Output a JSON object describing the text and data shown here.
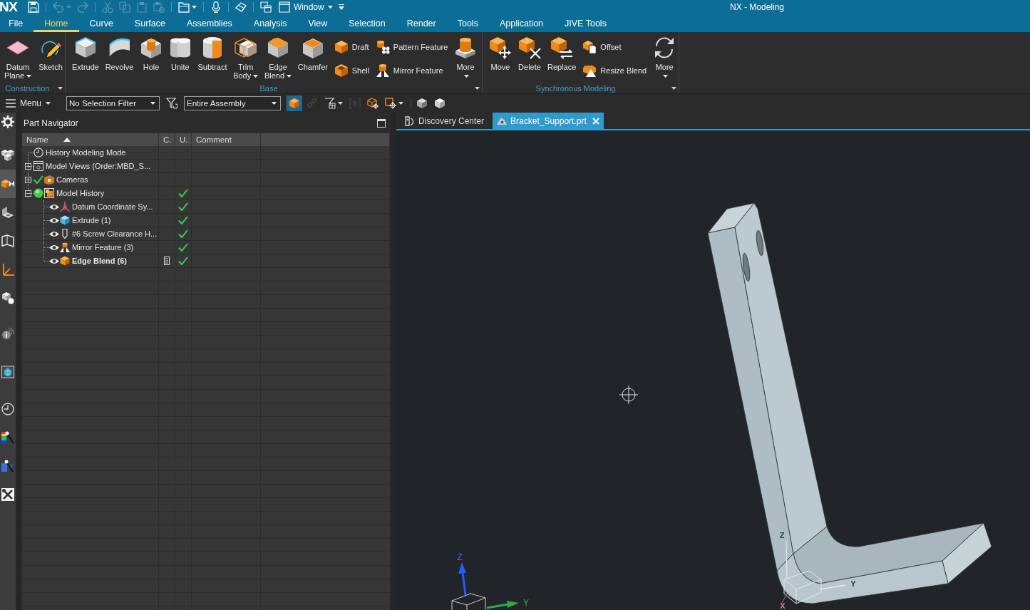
{
  "window": {
    "logo": "NX",
    "title": "NX - Modeling"
  },
  "quick_access": {
    "groups": [
      [
        {
          "disabled": false,
          "dropdown": false
        }
      ],
      [
        {
          "disabled": true,
          "dropdown": true
        },
        {
          "disabled": true,
          "dropdown": false
        }
      ],
      [
        {
          "disabled": true,
          "dropdown": false
        },
        {
          "disabled": true,
          "dropdown": false
        },
        {
          "disabled": true,
          "dropdown": false
        },
        {
          "disabled": true,
          "dropdown": false
        }
      ],
      [
        {
          "disabled": false,
          "dropdown": true
        }
      ],
      [
        {
          "disabled": false,
          "dropdown": false
        }
      ],
      [
        {
          "disabled": false,
          "dropdown": false
        }
      ],
      [
        {
          "disabled": false,
          "dropdown": false
        }
      ]
    ],
    "window_menu": "Window"
  },
  "ribbon_tabs": [
    {
      "label": "File",
      "selected": false
    },
    {
      "label": "Home",
      "selected": true
    },
    {
      "label": "Curve",
      "selected": false
    },
    {
      "label": "Surface",
      "selected": false
    },
    {
      "label": "Assemblies",
      "selected": false
    },
    {
      "label": "Analysis",
      "selected": false
    },
    {
      "label": "View",
      "selected": false
    },
    {
      "label": "Selection",
      "selected": false
    },
    {
      "label": "Render",
      "selected": false
    },
    {
      "label": "Tools",
      "selected": false
    },
    {
      "label": "Application",
      "selected": false
    },
    {
      "label": "JIVE Tools",
      "selected": false
    }
  ],
  "ribbon_groups": [
    {
      "title": "Construction",
      "items": [
        {
          "kind": "large",
          "label": "Datum Plane",
          "dropdown": true
        },
        {
          "kind": "large",
          "label": "Sketch",
          "dropdown": false
        }
      ]
    },
    {
      "title": "Base",
      "items": [
        {
          "kind": "large",
          "label": "Extrude",
          "dropdown": false
        },
        {
          "kind": "large",
          "label": "Revolve",
          "dropdown": false
        },
        {
          "kind": "large",
          "label": "Hole",
          "dropdown": false
        },
        {
          "kind": "large",
          "label": "Unite",
          "dropdown": false
        },
        {
          "kind": "large",
          "label": "Subtract",
          "dropdown": false
        },
        {
          "kind": "large",
          "label": "Trim Body",
          "dropdown": true
        },
        {
          "kind": "large",
          "label": "Edge Blend",
          "dropdown": true
        },
        {
          "kind": "large",
          "label": "Chamfer",
          "dropdown": false
        },
        {
          "kind": "stack",
          "items": [
            {
              "label": "Draft"
            },
            {
              "label": "Shell"
            }
          ]
        },
        {
          "kind": "stack",
          "items": [
            {
              "label": "Pattern Feature"
            },
            {
              "label": "Mirror Feature"
            }
          ]
        },
        {
          "kind": "large",
          "label": "More",
          "dropdown": true
        }
      ]
    },
    {
      "title": "Synchronous Modeling",
      "items": [
        {
          "kind": "large",
          "label": "Move",
          "dropdown": false
        },
        {
          "kind": "large",
          "label": "Delete",
          "dropdown": false
        },
        {
          "kind": "large",
          "label": "Replace",
          "dropdown": false
        },
        {
          "kind": "stack",
          "items": [
            {
              "label": "Offset"
            },
            {
              "label": "Resize Blend"
            }
          ]
        },
        {
          "kind": "large",
          "label": "More",
          "dropdown": true
        }
      ]
    }
  ],
  "toolbar": {
    "menu": "Menu",
    "selection_filter": "No Selection Filter",
    "scope": "Entire Assembly",
    "button_groups": [
      [
        {
          "selected": true,
          "disabled": false,
          "dropdown": false
        },
        {
          "selected": false,
          "disabled": true,
          "dropdown": false
        },
        {
          "selected": false,
          "disabled": false,
          "dropdown": true
        },
        {
          "selected": false,
          "disabled": true,
          "dropdown": false
        },
        {
          "selected": false,
          "disabled": false,
          "dropdown": false
        },
        {
          "selected": false,
          "disabled": false,
          "dropdown": true
        }
      ],
      [
        {
          "selected": false,
          "disabled": false,
          "dropdown": false
        },
        {
          "selected": false,
          "disabled": false,
          "dropdown": false
        }
      ]
    ]
  },
  "resource_bar": [
    {
      "selected": false
    },
    {
      "selected": false
    },
    {
      "selected": true
    },
    {
      "selected": false
    },
    {
      "selected": false
    },
    {
      "selected": false
    },
    {
      "selected": false
    },
    {
      "selected": false
    },
    {
      "selected": false
    },
    {
      "selected": false
    },
    {
      "selected": false
    },
    {
      "selected": false
    },
    {
      "selected": false
    }
  ],
  "part_navigator": {
    "title": "Part Navigator",
    "columns": [
      {
        "label": "Name",
        "sort_ascending": true
      },
      {
        "label": "C."
      },
      {
        "label": "U."
      },
      {
        "label": "Comment"
      }
    ],
    "tree": [
      {
        "kind": "node",
        "name": "History Modeling Mode",
        "checked": false,
        "active": false,
        "up_to_date": false
      },
      {
        "kind": "node",
        "name": "Model Views (Order:MBD_S...",
        "expanded": false,
        "checked": false,
        "active": false,
        "up_to_date": false
      },
      {
        "kind": "node",
        "name": "Cameras",
        "expanded": false,
        "checked": true,
        "active": false,
        "up_to_date": false
      },
      {
        "kind": "node",
        "name": "Model History",
        "expanded": true,
        "checked": false,
        "active": true,
        "up_to_date": true,
        "children": [
          {
            "kind": "feature",
            "name": "Datum Coordinate Sy...",
            "visible": true,
            "up_to_date": true,
            "current": false
          },
          {
            "kind": "feature",
            "name": "Extrude (1)",
            "visible": true,
            "up_to_date": true,
            "current": false
          },
          {
            "kind": "feature",
            "name": "#6 Screw Clearance H...",
            "visible": true,
            "up_to_date": true,
            "current": false
          },
          {
            "kind": "feature",
            "name": "Mirror Feature (3)",
            "visible": true,
            "up_to_date": true,
            "current": false
          },
          {
            "kind": "feature",
            "name": "Edge Blend (6)",
            "visible": true,
            "up_to_date": true,
            "current": true
          }
        ]
      }
    ]
  },
  "viewport": {
    "tabs": [
      {
        "label": "Discovery Center",
        "selected": false,
        "closable": false
      },
      {
        "label": "Bracket_Support.prt",
        "selected": true,
        "closable": true
      }
    ],
    "triad_labels": [
      "Z",
      "Y"
    ],
    "wcs_labels": [
      "Z",
      "Y",
      "X"
    ]
  }
}
